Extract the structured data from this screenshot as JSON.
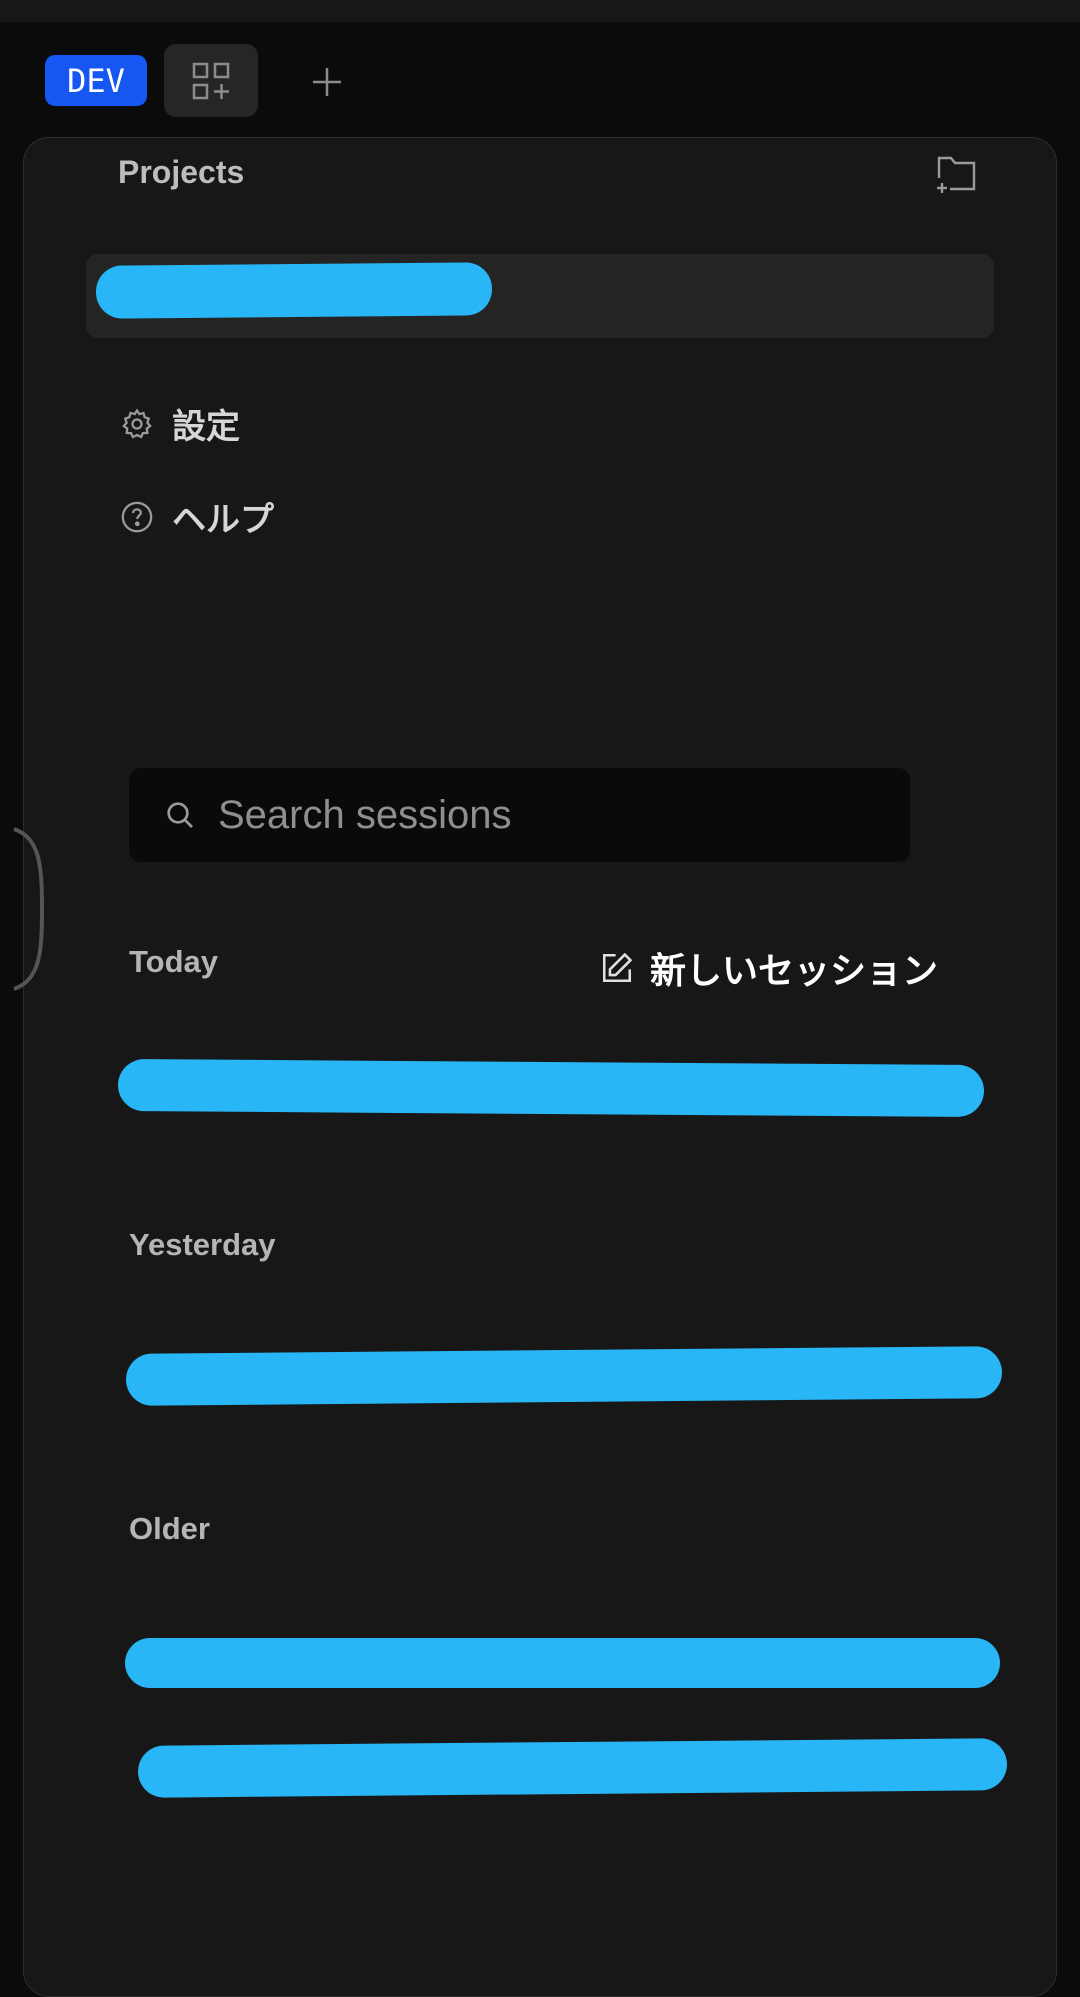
{
  "topbar": {
    "env_badge": "DEV",
    "apps_icon": "grid-plus-icon",
    "add_icon": "plus-icon"
  },
  "sidebar": {
    "projects_title": "Projects",
    "new_project_icon": "folder-plus-icon",
    "menu": [
      {
        "label": "設定",
        "icon": "gear-icon"
      },
      {
        "label": "ヘルプ",
        "icon": "help-circle-icon"
      }
    ]
  },
  "sessions": {
    "search_placeholder": "Search sessions",
    "new_session_label": "新しいセッション",
    "groups": [
      {
        "label": "Today"
      },
      {
        "label": "Yesterday"
      },
      {
        "label": "Older"
      }
    ]
  },
  "colors": {
    "background": "#0b0b0b",
    "panel": "#171717",
    "dev_badge": "#1557f0",
    "redaction": "#29b6f6"
  }
}
